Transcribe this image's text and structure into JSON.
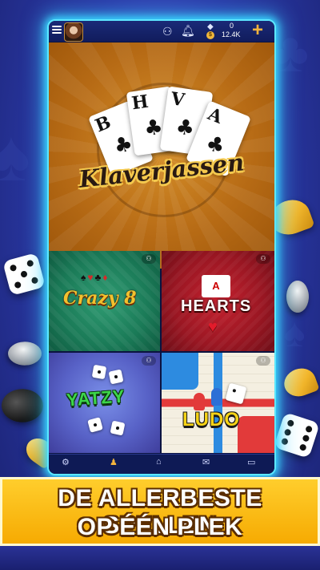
{
  "topbar": {
    "menu_icon": "hamburger-icon",
    "friends_icon": "friends-icon",
    "bell_icon": "bell-icon",
    "gem_icon": "diamond-icon",
    "gem_count": "0",
    "coin_icon": "coin-icon",
    "coin_symbol": "$",
    "coin_count": "12.4K",
    "add_label": "+"
  },
  "games": [
    {
      "name": "Klaverjassen",
      "cards": [
        "B",
        "H",
        "V",
        "A"
      ]
    },
    {
      "name": "Crazy 8"
    },
    {
      "name": "HEARTS",
      "card": "A"
    },
    {
      "name": "YATZY"
    },
    {
      "name": "LUDO"
    }
  ],
  "banner": {
    "line1": "DE ALLERBESTE SPELLEN",
    "line2": "OP ÉÉN PLEK"
  },
  "colors": {
    "accent_glow": "#38d8ff",
    "banner_yellow": "#ffcf2e",
    "klaverjassen_bg": "#b76b15",
    "crazy8_bg": "#1a7a57",
    "hearts_bg": "#991622",
    "yatzy_bg": "#5862c7"
  }
}
